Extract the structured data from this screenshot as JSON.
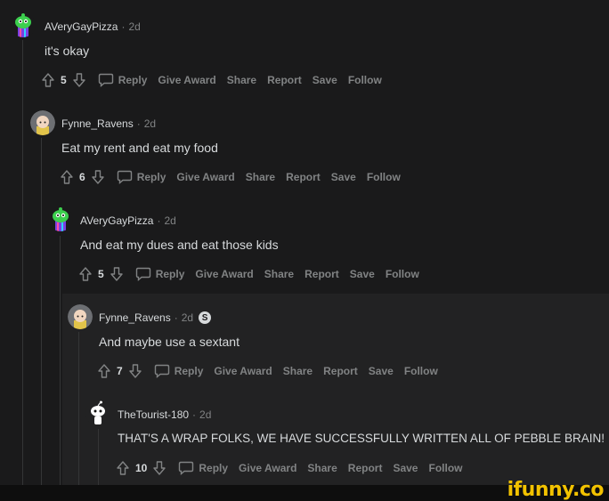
{
  "comments": [
    {
      "user": "AVeryGayPizza",
      "age": "2d",
      "text": "it's okay",
      "score": "5",
      "actions": {
        "reply": "Reply",
        "award": "Give Award",
        "share": "Share",
        "report": "Report",
        "save": "Save",
        "follow": "Follow"
      }
    },
    {
      "user": "Fynne_Ravens",
      "age": "2d",
      "text": "Eat my rent and eat my food",
      "score": "6",
      "actions": {
        "reply": "Reply",
        "award": "Give Award",
        "share": "Share",
        "report": "Report",
        "save": "Save",
        "follow": "Follow"
      }
    },
    {
      "user": "AVeryGayPizza",
      "age": "2d",
      "text": "And eat my dues and eat those kids",
      "score": "5",
      "actions": {
        "reply": "Reply",
        "award": "Give Award",
        "share": "Share",
        "report": "Report",
        "save": "Save",
        "follow": "Follow"
      }
    },
    {
      "user": "Fynne_Ravens",
      "age": "2d",
      "text": "And maybe use a sextant",
      "score": "7",
      "actions": {
        "reply": "Reply",
        "award": "Give Award",
        "share": "Share",
        "report": "Report",
        "save": "Save",
        "follow": "Follow"
      }
    },
    {
      "user": "TheTourist-180",
      "age": "2d",
      "text": "THAT'S A WRAP FOLKS, WE HAVE SUCCESSFULLY WRITTEN ALL OF PEBBLE BRAIN!",
      "score": "10",
      "actions": {
        "reply": "Reply",
        "award": "Give Award",
        "share": "Share",
        "report": "Report",
        "save": "Save",
        "follow": "Follow"
      }
    }
  ],
  "separator": "·",
  "badge_glyph": "S",
  "watermark": "ifunny.co",
  "colors": {
    "bg": "#1a1a1b",
    "text": "#d7dadc",
    "muted": "#818384",
    "watermark": "#f2c200"
  }
}
